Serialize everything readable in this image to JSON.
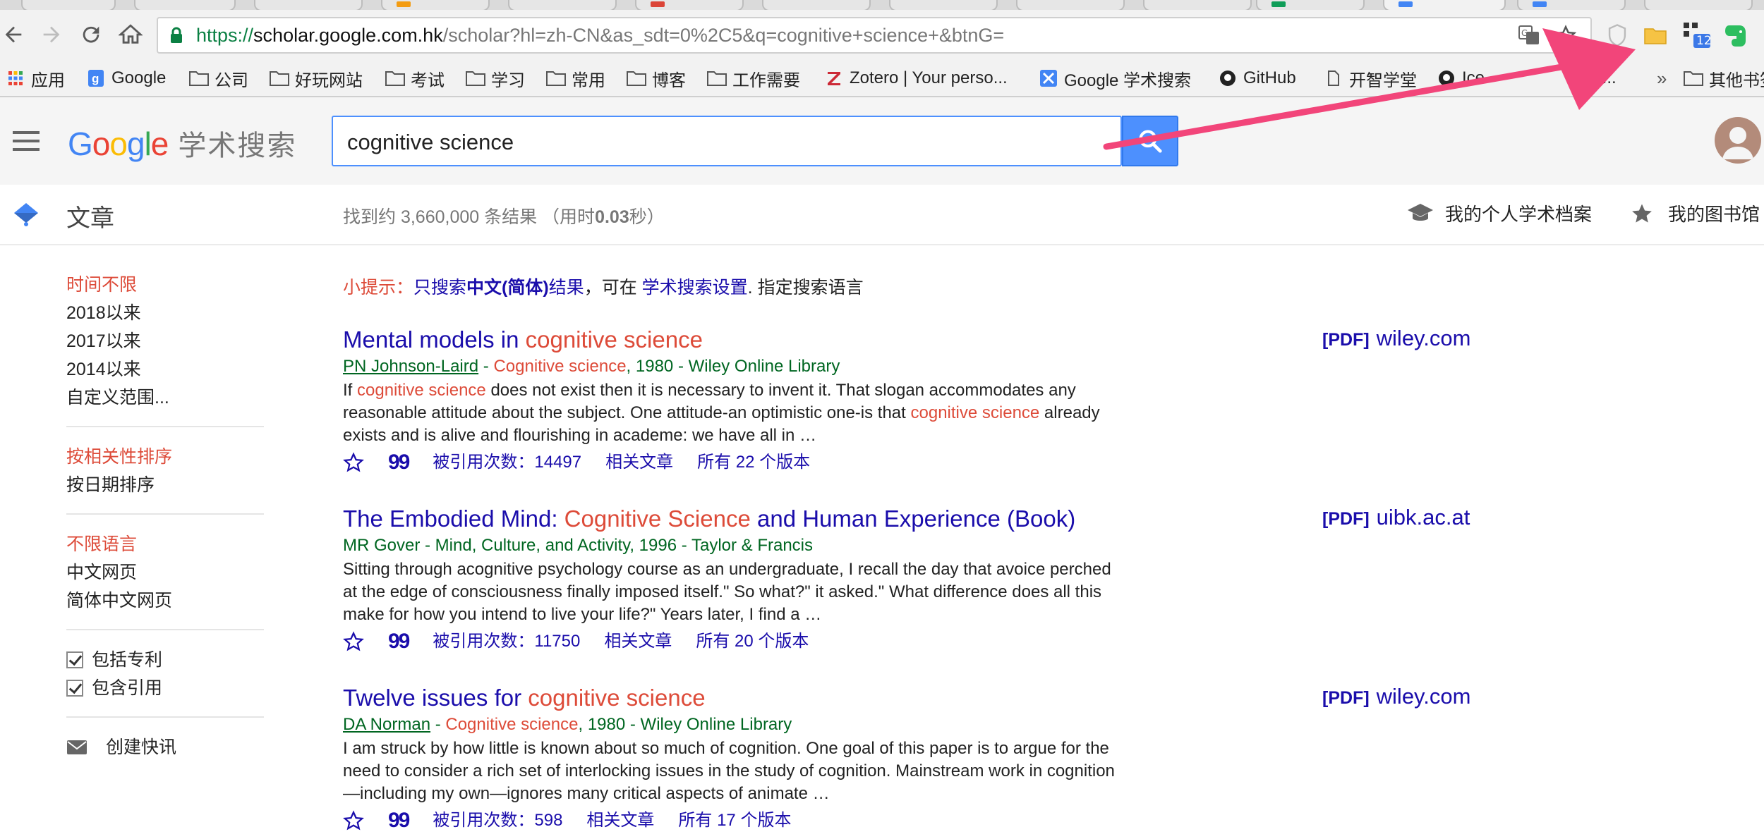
{
  "browser": {
    "url_scheme": "https://",
    "url_host": "scholar.google.com.hk",
    "url_path": "/scholar?hl=zh-CN&as_sdt=0%2C5&q=cognitive+science+&btnG=",
    "extension_badge": "12"
  },
  "bookmarks": [
    {
      "label": "应用",
      "icon": "apps-grid-icon"
    },
    {
      "label": "Google",
      "icon": "google-g-icon"
    },
    {
      "label": "公司",
      "icon": "folder-icon"
    },
    {
      "label": "好玩网站",
      "icon": "folder-icon"
    },
    {
      "label": "考试",
      "icon": "folder-icon"
    },
    {
      "label": "学习",
      "icon": "folder-icon"
    },
    {
      "label": "常用",
      "icon": "folder-icon"
    },
    {
      "label": "博客",
      "icon": "folder-icon"
    },
    {
      "label": "工作需要",
      "icon": "folder-icon"
    },
    {
      "label": "Zotero | Your perso...",
      "icon": "zotero-icon"
    },
    {
      "label": "Google 学术搜索",
      "icon": "scholar-icon"
    },
    {
      "label": "GitHub",
      "icon": "github-icon"
    },
    {
      "label": "开智学堂",
      "icon": "page-icon"
    },
    {
      "label": "Ice",
      "icon": "github-icon"
    },
    {
      "label": "rs/...",
      "icon": "page-icon"
    },
    {
      "label": "»",
      "icon": ""
    },
    {
      "label": "其他书签",
      "icon": "folder-icon"
    }
  ],
  "header": {
    "logo_suffix": "学术搜索",
    "search_value": "cognitive science"
  },
  "subheader": {
    "label": "文章",
    "stats_prefix": "找到约 3,660,000 条结果 （用时",
    "stats_time": "0.03",
    "stats_suffix": "秒）",
    "my_profile": "我的个人学术档案",
    "my_library": "我的图书馆"
  },
  "sidebar": {
    "time_filters": [
      "时间不限",
      "2018以来",
      "2017以来",
      "2014以来",
      "自定义范围..."
    ],
    "sort_options": [
      "按相关性排序",
      "按日期排序"
    ],
    "language_options": [
      "不限语言",
      "中文网页",
      "简体中文网页"
    ],
    "checkboxes": [
      "包括专利",
      "包含引用"
    ],
    "create_alert": "创建快讯"
  },
  "hint": {
    "label": "小提示：",
    "text1": "只搜索",
    "bold": "中文(简体)",
    "text2": "结果",
    "text3": "，可在 ",
    "settings_link": "学术搜索设置",
    "text4": ". 指定搜索语言"
  },
  "results": [
    {
      "title_a": "Mental models in ",
      "title_hl": "cognitive science",
      "title_b": "",
      "author": "PN Johnson-Laird",
      "meta_sep": " - ",
      "meta_hl": "Cognitive science",
      "meta_rest": ", 1980 - Wiley Online Library",
      "snippet_parts": [
        "If ",
        "cognitive science",
        " does not exist then it is necessary to invent it. That slogan accommodates any reasonable attitude about the subject. One attitude-an optimistic one-is that ",
        "cognitive science",
        " already exists and is alive and flourishing in academe: we have all in …"
      ],
      "cited": "被引用次数：14497",
      "related": "相关文章",
      "versions": "所有 22 个版本",
      "pdf_tag": "[PDF]",
      "pdf_host": "wiley.com"
    },
    {
      "title_a": "The Embodied Mind: ",
      "title_hl": "Cognitive Science",
      "title_b": " and Human Experience (Book)",
      "author": "",
      "meta_plain": "MR Gover - Mind, Culture, and Activity, 1996 - Taylor & Francis",
      "snippet": "Sitting through acognitive psychology course as an undergraduate, I recall the day that avoice perched at the edge of consciousness finally imposed itself.\" So what?\" it asked.\" What difference does all this make for how you intend to live your life?\" Years later, I find a …",
      "cited": "被引用次数：11750",
      "related": "相关文章",
      "versions": "所有 20 个版本",
      "pdf_tag": "[PDF]",
      "pdf_host": "uibk.ac.at"
    },
    {
      "title_a": "Twelve issues for ",
      "title_hl": "cognitive science",
      "title_b": "",
      "author": "DA Norman",
      "meta_sep": " - ",
      "meta_hl": "Cognitive science",
      "meta_rest": ", 1980 - Wiley Online Library",
      "snippet": "I am struck by how little is known about so much of cognition. One goal of this paper is to argue for the need to consider a rich set of interlocking issues in the study of cognition. Mainstream work in cognition—including my own—ignores many critical aspects of animate …",
      "cited": "被引用次数：598",
      "related": "相关文章",
      "versions": "所有 17 个版本",
      "pdf_tag": "[PDF]",
      "pdf_host": "wiley.com"
    }
  ],
  "colors": {
    "accent_blue": "#4d90fe",
    "link_blue": "#1a0dab",
    "highlight_red": "#dd4b39",
    "meta_green": "#006621",
    "annotation_pink": "#f2457a"
  }
}
